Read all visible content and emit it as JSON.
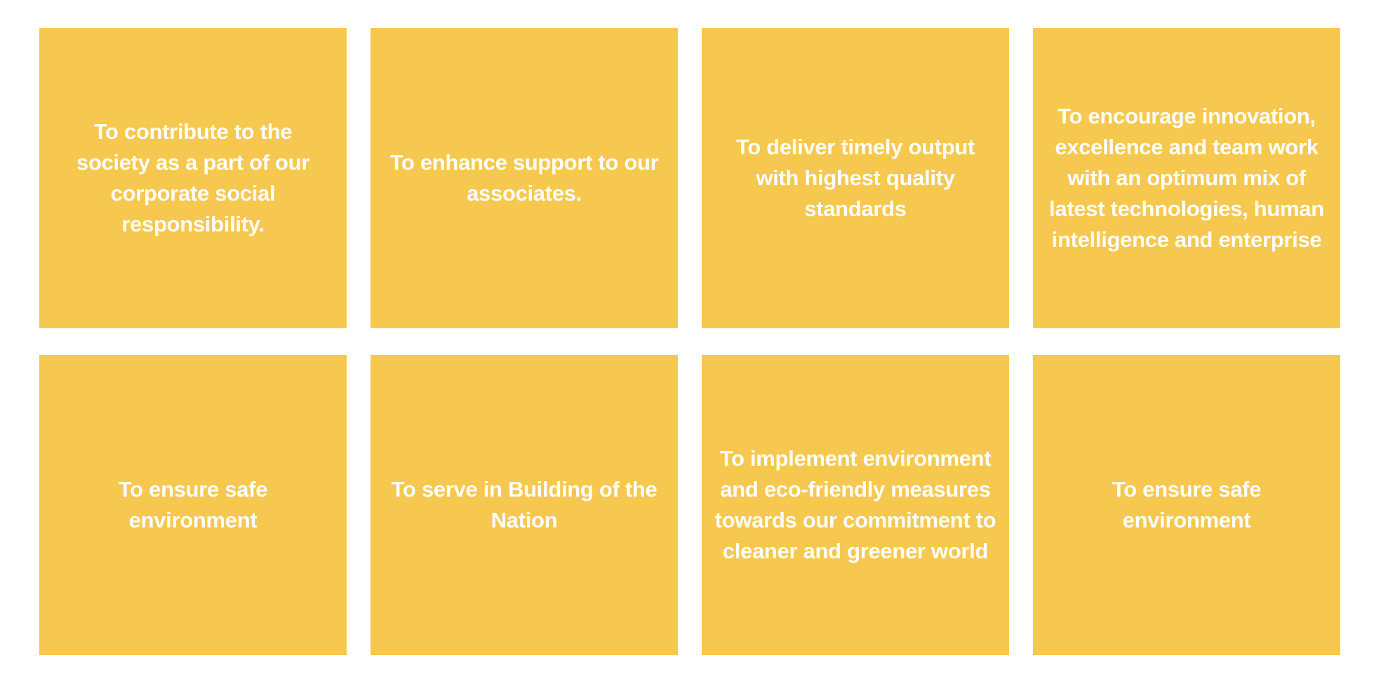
{
  "colors": {
    "tile_background": "#F6C84F",
    "tile_text": "#FFFFFF",
    "page_background": "#FFFFFF"
  },
  "tiles": [
    {
      "text": "To contribute to the society as a part of our corporate social responsibility."
    },
    {
      "text": "To enhance support to our associates."
    },
    {
      "text": "To deliver timely output with highest quality standards"
    },
    {
      "text": "To encourage innovation, excellence and team work with an optimum mix of latest technologies, human intelligence and enterprise"
    },
    {
      "text": "To ensure safe environment"
    },
    {
      "text": "To serve in Building of the Nation"
    },
    {
      "text": "To implement environment and eco-friendly measures towards our commitment to cleaner and greener world"
    },
    {
      "text": "To ensure safe environment"
    }
  ]
}
